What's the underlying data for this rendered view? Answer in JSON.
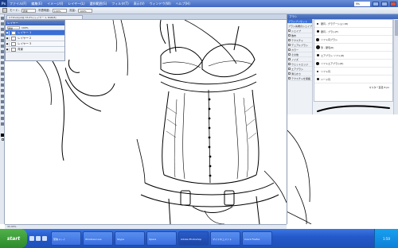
{
  "app": {
    "logo": "Ps",
    "menu": [
      "ファイル(F)",
      "編集(E)",
      "イメージ(I)",
      "レイヤー(L)",
      "選択範囲(S)",
      "フィルタ(T)",
      "表示(V)",
      "ウィンドウ(W)",
      "ヘルプ(H)"
    ],
    "zoom_value": "Ms"
  },
  "options": {
    "labels": [
      "モード:",
      "不透明度:",
      "流量:"
    ],
    "values": [
      "通常",
      "100%",
      "100%"
    ]
  },
  "document": {
    "tab_label": "4 Tlmodyid@ 33.3% (レイヤー 1, RGB/8)"
  },
  "layers": {
    "title": "レイヤー",
    "blend": "通常",
    "opacity": "100%",
    "items": [
      {
        "name": "レイヤー 1",
        "active": true
      },
      {
        "name": "レイヤー 2",
        "active": false
      },
      {
        "name": "レイヤー 3",
        "active": false
      },
      {
        "name": "背景",
        "active": false
      }
    ]
  },
  "brush_panel": {
    "title": "ブラシ",
    "presets": [
      "ブラシプリセット",
      "ブラシ先端のシェイプ",
      "シェイプ",
      "散布",
      "テクスチャ",
      "デュアルブラシ",
      "カラー",
      "その他",
      "ノイズ",
      "ウェットエッジ",
      "エアブラシ",
      "滑らかさ",
      "テクスチャを保護"
    ],
    "brushes": [
      "硬円 - グラデーション(R)",
      "硬円 - ブラシ(F)",
      "ソフト円ブラシ",
      "筆 - 硬毛(R)",
      "エアブラシ ソフト(R)",
      "ソフトエアブラシ(R)",
      "ソフト円",
      "ハード円"
    ],
    "footer_label": "マスター直径",
    "footer_value": "8 px"
  },
  "status": {
    "text": "33.33%"
  },
  "taskbar": {
    "start": "start",
    "tasks": [
      "受信トレイ",
      "Windows Live",
      "Skype",
      "Opera",
      "Adobe Photoshop",
      "マイドキュメント",
      "Crack Firefox"
    ],
    "clock": "1:50"
  }
}
